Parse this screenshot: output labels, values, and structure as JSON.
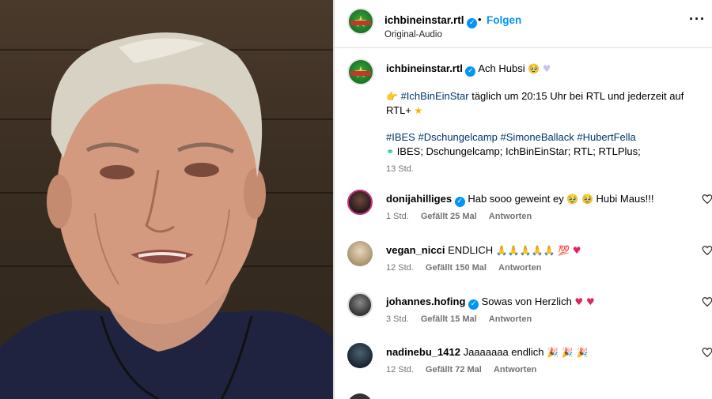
{
  "header": {
    "username": "ichbineinstar.rtl",
    "follow_label": "Folgen",
    "audio_label": "Original-Audio",
    "more_icon": "more-horizontal-icon"
  },
  "caption": {
    "username": "ichbineinstar.rtl",
    "first_text": "Ach Hubsi",
    "pointer_emoji": "👉",
    "hashtag_main": "#IchBinEinStar",
    "line2_text": "täglich um 20:15 Uhr bei RTL und jederzeit auf",
    "line2_cont": "RTL+",
    "hashtags": "#IBES #Dschungelcamp #SimoneBallack #HubertFella",
    "tags_line": "IBES; Dschungelcamp; IchBinEinStar; RTL; RTLPlus;",
    "time": "13 Std."
  },
  "comments": [
    {
      "user": "donijahilliges",
      "verified": true,
      "text": "Hab sooo geweint ey",
      "text2": "Hubi Maus!!!",
      "time": "1 Std.",
      "likes": "Gefällt 25 Mal",
      "reply": "Antworten",
      "avatar_color": "#3a2a2a"
    },
    {
      "user": "vegan_nicci",
      "verified": false,
      "text": "ENDLICH",
      "text2": "",
      "time": "12 Std.",
      "likes": "Gefällt 150 Mal",
      "reply": "Antworten",
      "avatar_color": "#b8a98a"
    },
    {
      "user": "johannes.hofing",
      "verified": true,
      "text": "Sowas von Herzlich",
      "text2": "",
      "time": "3 Std.",
      "likes": "Gefällt 15 Mal",
      "reply": "Antworten",
      "avatar_color": "#555555"
    },
    {
      "user": "nadinebu_1412",
      "verified": false,
      "text": "Jaaaaaaa endlich",
      "text2": "",
      "time": "12 Std.",
      "likes": "Gefällt 72 Mal",
      "reply": "Antworten",
      "avatar_color": "#2c3e50"
    }
  ],
  "colors": {
    "link_blue": "#0095f6",
    "hashtag": "#00376b",
    "meta_gray": "#737373"
  }
}
